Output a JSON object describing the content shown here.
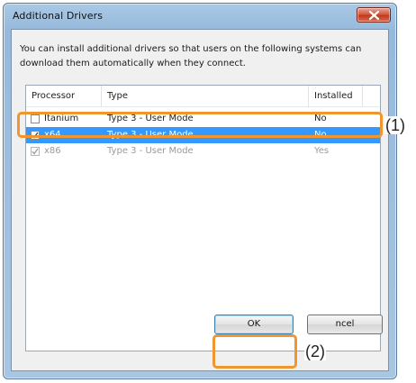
{
  "window": {
    "title": "Additional Drivers",
    "description": "You can install additional drivers so that users on the following systems can download them automatically when they connect."
  },
  "listview": {
    "columns": [
      "Processor",
      "Type",
      "Installed"
    ],
    "rows": [
      {
        "processor": "Itanium",
        "type": "Type 3 - User Mode",
        "installed": "No",
        "checked": false,
        "state": "normal"
      },
      {
        "processor": "x64",
        "type": "Type 3 - User Mode",
        "installed": "No",
        "checked": true,
        "state": "selected"
      },
      {
        "processor": "x86",
        "type": "Type 3 - User Mode",
        "installed": "Yes",
        "checked": true,
        "state": "disabled"
      }
    ]
  },
  "buttons": {
    "ok": "OK",
    "cancel": "ncel"
  },
  "callouts": {
    "step1": "(1)",
    "step2": "(2)"
  },
  "colors": {
    "selection": "#3399ff",
    "callout": "#f0962e",
    "close_button": "#c13a1e"
  },
  "icons": [
    "close-icon",
    "checkmark-icon"
  ]
}
